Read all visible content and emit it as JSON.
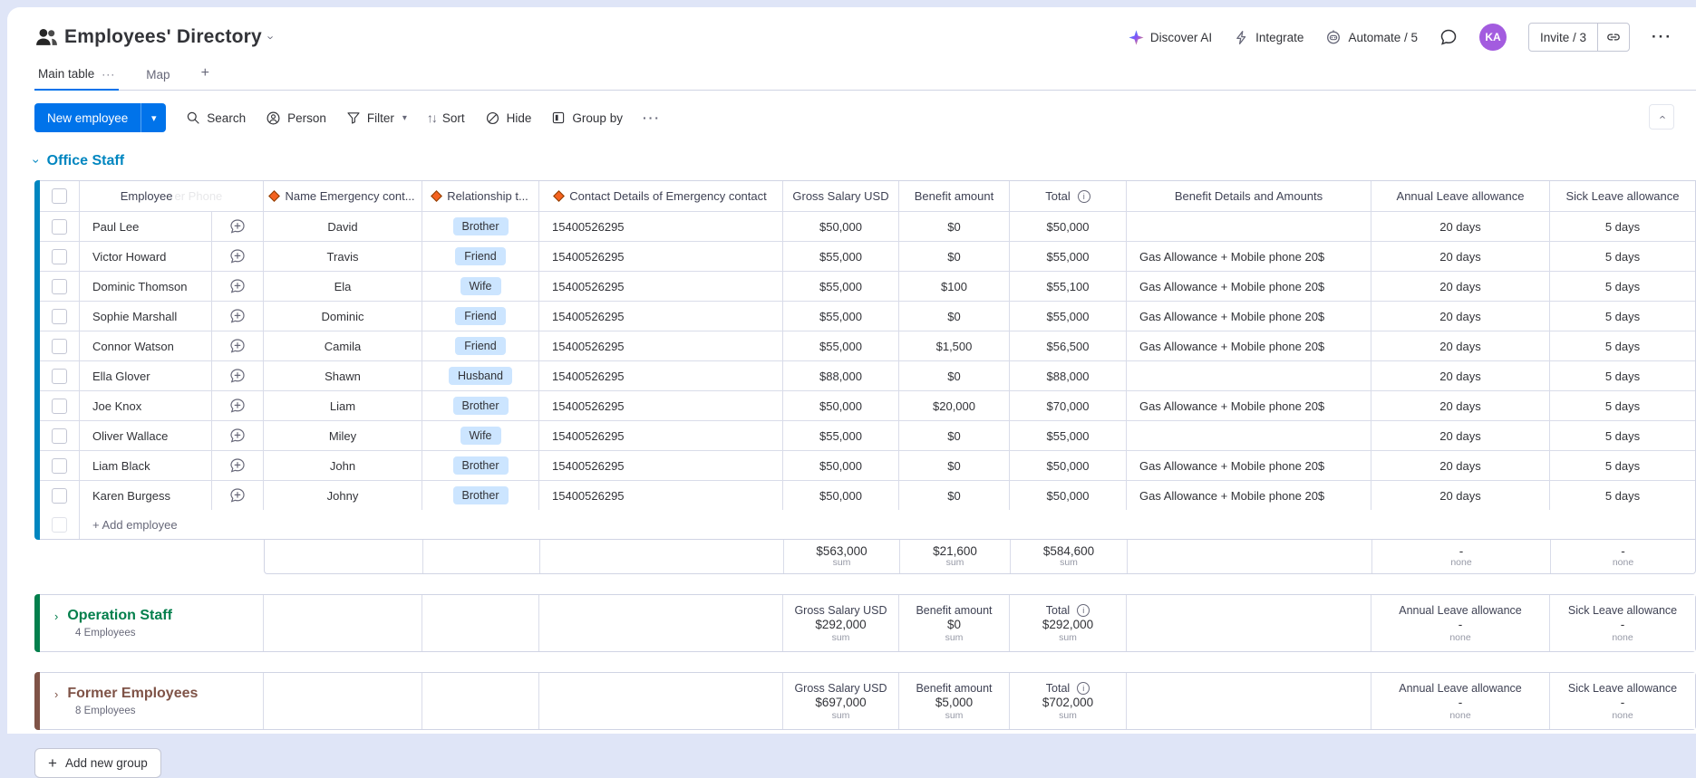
{
  "topbar": {
    "title": "Employees' Directory",
    "discover_ai": "Discover AI",
    "integrate": "Integrate",
    "automate": "Automate / 5",
    "invite": "Invite / 3",
    "avatar_initials": "KA",
    "more": "···"
  },
  "tabs": {
    "main_table": "Main table",
    "main_table_menu": "···",
    "map": "Map",
    "add_tab": "+"
  },
  "toolbar": {
    "new_employee": "New employee",
    "new_employee_caret": "▾",
    "search": "Search",
    "person": "Person",
    "filter": "Filter",
    "sort": "Sort",
    "sort_glyph": "↑↓",
    "hide": "Hide",
    "group_by": "Group by",
    "more": "···"
  },
  "table": {
    "columns": {
      "employee": "Employee",
      "ghost": "er Phone",
      "emergency_name": "Name Emergency cont...",
      "relationship": "Relationship t...",
      "contact": "Contact Details of Emergency contact",
      "gross": "Gross Salary USD",
      "benefit": "Benefit amount",
      "total": "Total",
      "benefit_details": "Benefit Details and Amounts",
      "annual_leave": "Annual Leave allowance",
      "sick_leave": "Sick Leave allowance"
    },
    "sum_label": "sum",
    "none_label": "none",
    "dash": "-",
    "info_glyph": "i"
  },
  "groups": {
    "office": {
      "name": "Office Staff",
      "color": "#0086c0",
      "add_row": "+ Add employee",
      "rows": [
        {
          "name": "Paul Lee",
          "emergency": "David",
          "relationship": "Brother",
          "contact": "15400526295",
          "gross": "$50,000",
          "benefit": "$0",
          "total": "$50,000",
          "details": "",
          "annual": "20 days",
          "sick": "5 days"
        },
        {
          "name": "Victor Howard",
          "emergency": "Travis",
          "relationship": "Friend",
          "contact": "15400526295",
          "gross": "$55,000",
          "benefit": "$0",
          "total": "$55,000",
          "details": "Gas Allowance + Mobile phone 20$",
          "annual": "20 days",
          "sick": "5 days"
        },
        {
          "name": "Dominic Thomson",
          "emergency": "Ela",
          "relationship": "Wife",
          "contact": "15400526295",
          "gross": "$55,000",
          "benefit": "$100",
          "total": "$55,100",
          "details": "Gas Allowance + Mobile phone 20$",
          "annual": "20 days",
          "sick": "5 days"
        },
        {
          "name": "Sophie Marshall",
          "emergency": "Dominic",
          "relationship": "Friend",
          "contact": "15400526295",
          "gross": "$55,000",
          "benefit": "$0",
          "total": "$55,000",
          "details": "Gas Allowance + Mobile phone 20$",
          "annual": "20 days",
          "sick": "5 days"
        },
        {
          "name": "Connor Watson",
          "emergency": "Camila",
          "relationship": "Friend",
          "contact": "15400526295",
          "gross": "$55,000",
          "benefit": "$1,500",
          "total": "$56,500",
          "details": "Gas Allowance + Mobile phone 20$",
          "annual": "20 days",
          "sick": "5 days"
        },
        {
          "name": "Ella Glover",
          "emergency": "Shawn",
          "relationship": "Husband",
          "contact": "15400526295",
          "gross": "$88,000",
          "benefit": "$0",
          "total": "$88,000",
          "details": "",
          "annual": "20 days",
          "sick": "5 days"
        },
        {
          "name": "Joe Knox",
          "emergency": "Liam",
          "relationship": "Brother",
          "contact": "15400526295",
          "gross": "$50,000",
          "benefit": "$20,000",
          "total": "$70,000",
          "details": "Gas Allowance + Mobile phone 20$",
          "annual": "20 days",
          "sick": "5 days"
        },
        {
          "name": "Oliver Wallace",
          "emergency": "Miley",
          "relationship": "Wife",
          "contact": "15400526295",
          "gross": "$55,000",
          "benefit": "$0",
          "total": "$55,000",
          "details": "",
          "annual": "20 days",
          "sick": "5 days"
        },
        {
          "name": "Liam Black",
          "emergency": "John",
          "relationship": "Brother",
          "contact": "15400526295",
          "gross": "$50,000",
          "benefit": "$0",
          "total": "$50,000",
          "details": "Gas Allowance + Mobile phone 20$",
          "annual": "20 days",
          "sick": "5 days"
        },
        {
          "name": "Karen Burgess",
          "emergency": "Johny",
          "relationship": "Brother",
          "contact": "15400526295",
          "gross": "$50,000",
          "benefit": "$0",
          "total": "$50,000",
          "details": "Gas Allowance + Mobile phone 20$",
          "annual": "20 days",
          "sick": "5 days"
        }
      ],
      "sums": {
        "gross": "$563,000",
        "benefit": "$21,600",
        "total": "$584,600"
      }
    },
    "operation": {
      "name": "Operation Staff",
      "count": "4 Employees",
      "color": "#037f4c",
      "chevron": "›",
      "sums": {
        "gross": "$292,000",
        "benefit": "$0",
        "total": "$292,000"
      }
    },
    "former": {
      "name": "Former Employees",
      "count": "8 Employees",
      "color": "#7f5347",
      "chevron": "›",
      "sums": {
        "gross": "$697,000",
        "benefit": "$5,000",
        "total": "$702,000"
      }
    }
  },
  "footer": {
    "add_group": "Add new group"
  },
  "colors": {
    "accent": "#0073ea",
    "badge_bg": "#cce5ff"
  }
}
